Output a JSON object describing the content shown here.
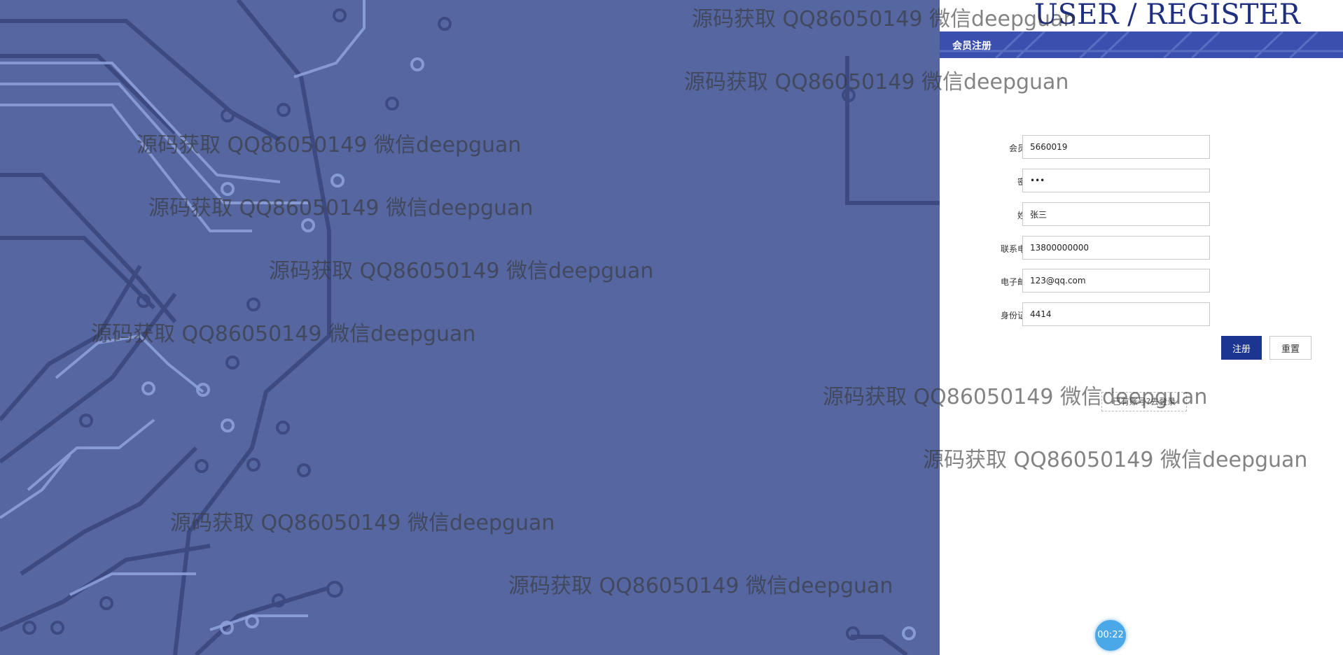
{
  "register_panel": {
    "title": "USER / REGISTER",
    "bar_label": "会员注册",
    "fields": [
      {
        "label": "会员号:",
        "value": "5660019"
      },
      {
        "label": "密码:",
        "value": "•••"
      },
      {
        "label": "姓名:",
        "value": "张三"
      },
      {
        "label": "联系电话:",
        "value": "13800000000"
      },
      {
        "label": "电子邮箱:",
        "value": "123@qq.com"
      },
      {
        "label": "身份证号:",
        "value": "4414"
      }
    ],
    "register_button": "注册",
    "reset_button": "重置",
    "login_link": "已有账号?去登录"
  },
  "timer": {
    "value": "00:22"
  },
  "watermark": {
    "text": "源码获取 QQ86050149 微信deepguan"
  },
  "colors": {
    "left_background": "#5566a0",
    "brand_blue": "#1c3590",
    "title_color": "#1e2f80",
    "timer_color": "#4aa8e8"
  }
}
